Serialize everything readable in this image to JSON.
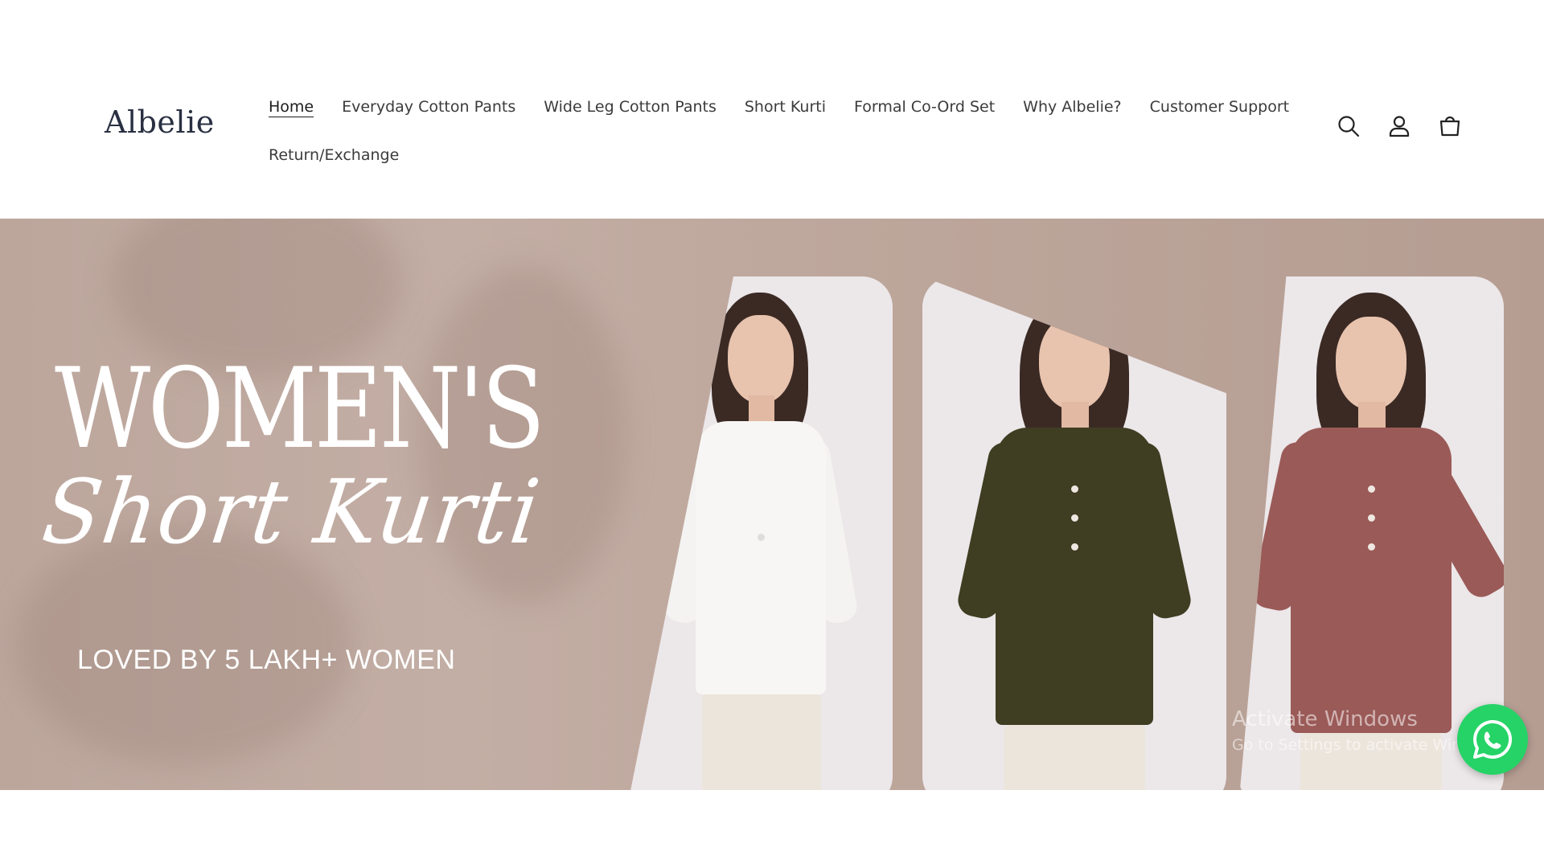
{
  "brand": {
    "logo_text": "Albelie"
  },
  "nav": {
    "row1": [
      {
        "label": "Home",
        "active": true
      },
      {
        "label": "Everyday Cotton Pants"
      },
      {
        "label": "Wide Leg Cotton Pants"
      },
      {
        "label": "Short Kurti"
      },
      {
        "label": "Formal Co-Ord Set"
      },
      {
        "label": "Why Albelie?"
      },
      {
        "label": "Customer Support"
      }
    ],
    "row2": [
      {
        "label": "Return/Exchange"
      }
    ]
  },
  "header_icons": [
    "search-icon",
    "account-icon",
    "cart-icon"
  ],
  "hero": {
    "title": "WOMEN'S",
    "script_title": "Short Kurti",
    "tagline": "LOVED BY 5 LAKH+ WOMEN",
    "models": [
      {
        "top_color": "#f7f6f4",
        "description_icon": "model-white-kurti"
      },
      {
        "top_color": "#3f3d22",
        "description_icon": "model-olive-kurti"
      },
      {
        "top_color": "#9a5a57",
        "description_icon": "model-rose-kurti"
      }
    ]
  },
  "watermark": {
    "title": "Activate Windows",
    "subtitle": "Go to Settings to activate Windows."
  },
  "whatsapp": {
    "icon": "whatsapp-icon",
    "color": "#25d366"
  },
  "colors": {
    "hero_bg": "#bfa99f",
    "text_dark": "#1f1f1f",
    "logo": "#2a3042"
  }
}
